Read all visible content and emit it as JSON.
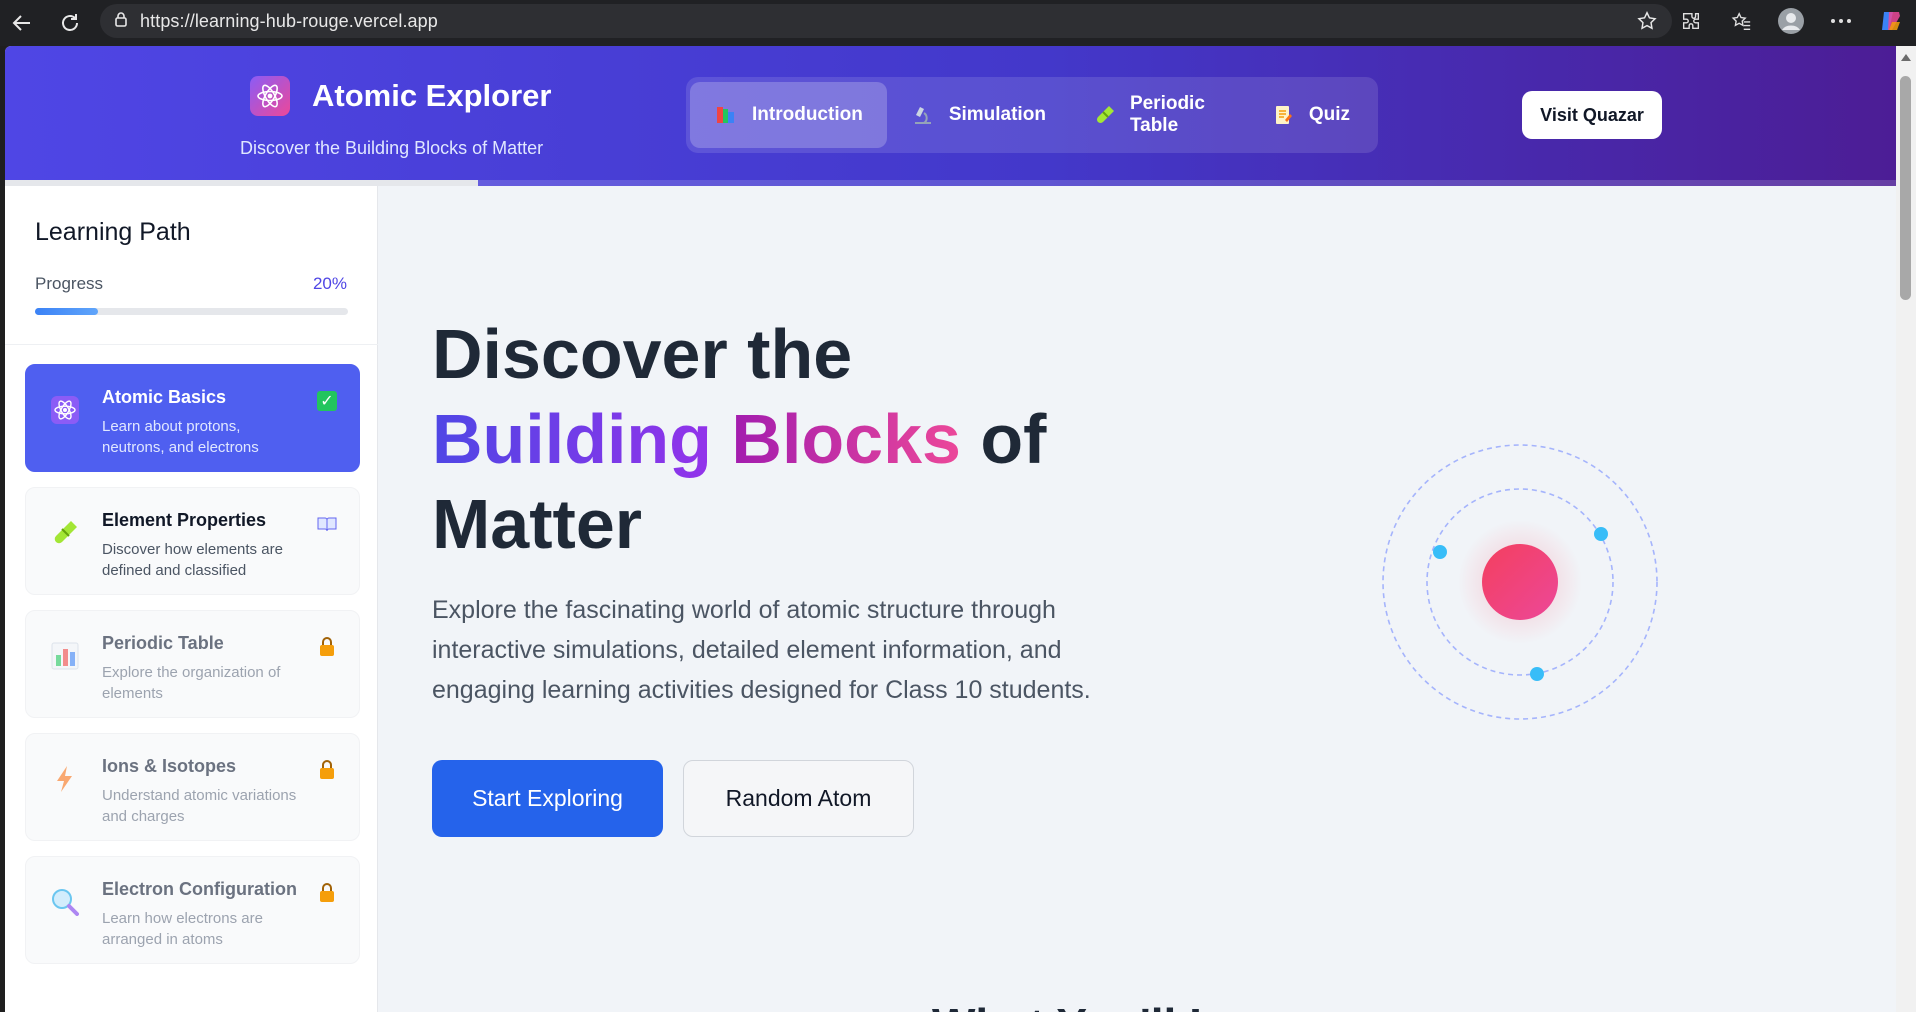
{
  "browser": {
    "url": "https://learning-hub-rouge.vercel.app"
  },
  "header": {
    "app_title": "Atomic Explorer",
    "tagline": "Discover the Building Blocks of Matter",
    "tabs": [
      {
        "label": "Introduction",
        "icon": "books-icon",
        "active": true
      },
      {
        "label": "Simulation",
        "icon": "microscope-icon",
        "active": false
      },
      {
        "label": "Periodic Table",
        "icon": "test-tube-icon",
        "active": false
      },
      {
        "label": "Quiz",
        "icon": "memo-icon",
        "active": false
      }
    ],
    "visit_button": "Visit Quazar",
    "section_progress": 0.25
  },
  "sidebar": {
    "title": "Learning Path",
    "progress_label": "Progress",
    "progress_value": "20%",
    "progress_fraction": 0.2,
    "lessons": [
      {
        "title": "Atomic Basics",
        "description": "Learn about protons, neutrons, and electrons",
        "icon": "atom-icon",
        "status": "completed",
        "active": true
      },
      {
        "title": "Element Properties",
        "description": "Discover how elements are defined and classified",
        "icon": "test-tube-icon",
        "status": "available",
        "active": false
      },
      {
        "title": "Periodic Table",
        "description": "Explore the organization of elements",
        "icon": "bar-chart-icon",
        "status": "locked",
        "active": false
      },
      {
        "title": "Ions & Isotopes",
        "description": "Understand atomic variations and charges",
        "icon": "lightning-icon",
        "status": "locked",
        "active": false
      },
      {
        "title": "Electron Configuration",
        "description": "Learn how electrons are arranged in atoms",
        "icon": "magnifier-icon",
        "status": "locked",
        "active": false
      }
    ]
  },
  "hero": {
    "title_line1": "Discover the",
    "title_word_gradient1": "Building",
    "title_word_gradient2": "Blocks",
    "title_word_of": "of",
    "title_line3": "Matter",
    "description": "Explore the fascinating world of atomic structure through interactive simulations, detailed element information, and engaging learning activities designed for Class 10 students.",
    "primary_button": "Start Exploring",
    "secondary_button": "Random Atom",
    "next_section_heading": "What You'll Learn"
  },
  "colors": {
    "header_start": "#4f46e5",
    "header_end": "#4c1d95",
    "primary_button": "#2563eb",
    "active_lesson": "#4f5ff0",
    "nucleus": "#f43f5e",
    "electron": "#38bdf8"
  }
}
